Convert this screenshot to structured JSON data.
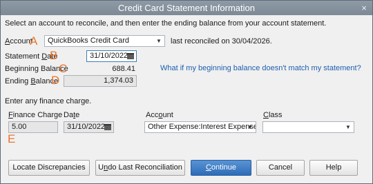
{
  "window": {
    "title": "Credit Card Statement Information",
    "close_glyph": "×"
  },
  "intro": "Select an account to reconcile, and then enter the ending balance from your account statement.",
  "account": {
    "label_prefix": "",
    "label_underlined": "A",
    "label_rest": "ccount",
    "marker": "A",
    "value": "QuickBooks Credit Card",
    "last_reconciled": "last reconciled on 30/04/2026."
  },
  "statement_date": {
    "label_prefix": "Statement ",
    "label_underlined": "D",
    "label_rest": "ate",
    "marker": "B",
    "value": "31/10/2022"
  },
  "beginning_balance": {
    "label": "Beginning Balance",
    "marker": "C",
    "value": "688.41",
    "help_link": "What if my beginning balance doesn't match my statement?"
  },
  "ending_balance": {
    "label_prefix": "Ending ",
    "label_underlined": "B",
    "label_rest": "alance",
    "marker": "D",
    "value": "1,374.03"
  },
  "finance": {
    "heading": "Enter any finance charge.",
    "charge_label_underlined": "F",
    "charge_label_rest": "inance Charge",
    "charge_value": "5.00",
    "date_label_prefix": "Da",
    "date_label_underlined": "t",
    "date_label_rest": "e",
    "date_value": "31/10/2022",
    "account_label_prefix": "Acc",
    "account_label_underlined": "o",
    "account_label_rest": "unt",
    "account_value": "Other Expense:Interest Expense",
    "class_label_underlined": "C",
    "class_label_rest": "lass",
    "class_value": "",
    "marker": "E"
  },
  "buttons": {
    "locate": "Locate Discrepancies",
    "undo_prefix": "U",
    "undo_underlined": "n",
    "undo_rest": "do Last Reconciliation",
    "continue_underlined": "C",
    "continue_rest": "ontinue",
    "cancel": "Cancel",
    "help": "Help"
  },
  "colors": {
    "titlebar": "#8e9aa6",
    "marker": "#e8762d",
    "link": "#1c5eb0",
    "primary_button": "#2d6db8"
  },
  "icons": [
    "close-icon",
    "dropdown-arrow-icon",
    "calendar-icon"
  ]
}
